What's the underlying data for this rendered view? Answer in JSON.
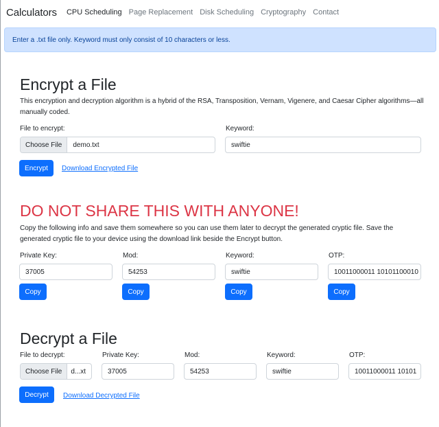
{
  "navbar": {
    "brand": "Calculators",
    "links": [
      "CPU Scheduling",
      "Page Replacement",
      "Disk Scheduling",
      "Cryptography",
      "Contact"
    ]
  },
  "alert": {
    "text": "Enter a .txt file only. Keyword must only consist of 10 characters or less."
  },
  "encrypt": {
    "title": "Encrypt a File",
    "description": "This encryption and decryption algorithm is a hybrid of the RSA, Transposition, Vernam, Vigenere, and Caesar Cipher algorithms—all manually coded.",
    "file_label": "File to encrypt:",
    "choose_file": "Choose File",
    "file_name": "demo.txt",
    "keyword_label": "Keyword:",
    "keyword_value": "swiftie",
    "button": "Encrypt",
    "download_link": "Download Encrypted File"
  },
  "warning": {
    "title": "DO NOT SHARE THIS WITH ANYONE!",
    "description": "Copy the following info and save them somewhere so you can use them later to decrypt the generated cryptic file. Save the generated cryptic file to your device using the download link beside the Encrypt button.",
    "fields": [
      {
        "label": "Private Key:",
        "value": "37005",
        "button": "Copy"
      },
      {
        "label": "Mod:",
        "value": "54253",
        "button": "Copy"
      },
      {
        "label": "Keyword:",
        "value": "swiftie",
        "button": "Copy"
      },
      {
        "label": "OTP:",
        "value": "10011000011 10101100010",
        "button": "Copy"
      }
    ]
  },
  "decrypt": {
    "title": "Decrypt a File",
    "file_label": "File to decrypt:",
    "choose_file": "Choose File",
    "file_name": "d...xt",
    "private_key_label": "Private Key:",
    "private_key_value": "37005",
    "mod_label": "Mod:",
    "mod_value": "54253",
    "keyword_label": "Keyword:",
    "keyword_value": "swiftie",
    "otp_label": "OTP:",
    "otp_value": "10011000011 10101",
    "button": "Decrypt",
    "download_link": "Download Decrypted File"
  },
  "colors": {
    "primary": "#0d6efd",
    "danger": "#dc3545",
    "alert_bg": "#cfe2ff",
    "alert_text": "#084298"
  }
}
